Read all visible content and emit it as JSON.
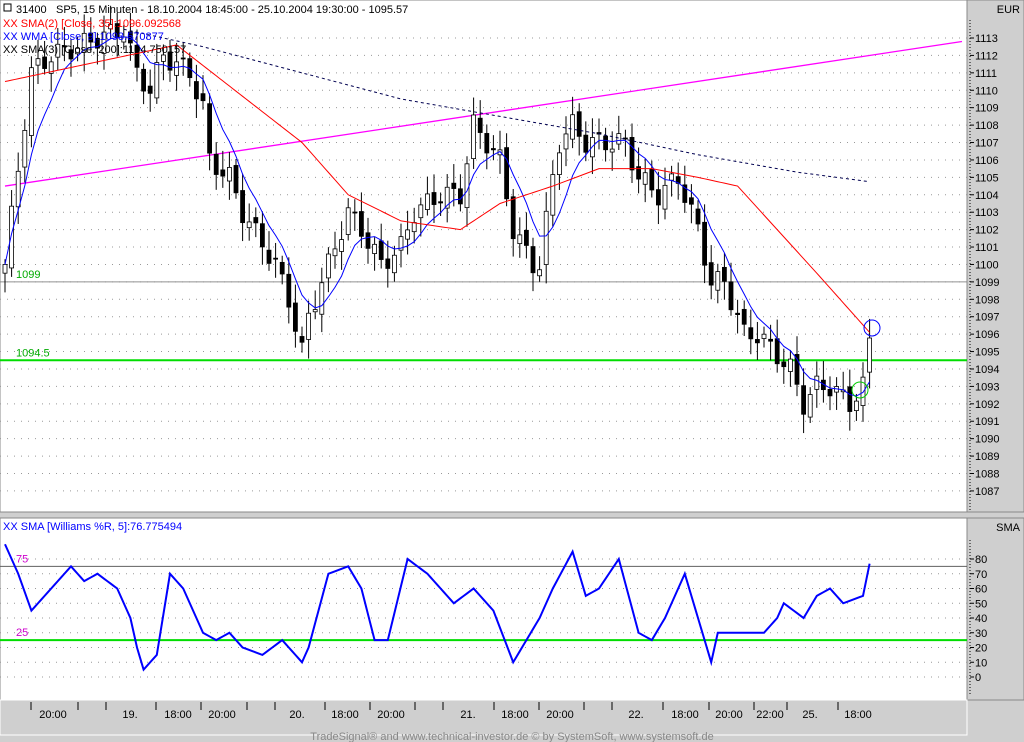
{
  "header": {
    "symbol_id": "31400",
    "title": "SP5, 15 Minuten - 18.10.2004 18:45:00 - 25.10.2004 19:30:00 - 1095.57",
    "legend": [
      {
        "text": "XX SMA(2) [Close, 35]:1096.092568",
        "color": "#ff0000"
      },
      {
        "text": "XX WMA [Close, 9]:1093.570877",
        "color": "#0000ff"
      },
      {
        "text": "XX SMA(3) [Close, 200]:1104.750157",
        "color": "#000000"
      }
    ]
  },
  "lower_legend": {
    "text": "XX SMA [Williams %R, 5]:76.775494",
    "color": "#0000ff"
  },
  "currency": "EUR",
  "lower_axis_label": "SMA",
  "footer": "TradeSignal® and www.technical-investor.de © by SystemSoft, www.systemsoft.de",
  "colors": {
    "sma35": "#ff0000",
    "wma9": "#0000ff",
    "sma200": "#000050",
    "trend": "#ff00ff",
    "support": "#00dd00",
    "resistance": "#909090",
    "wr": "#0000ff"
  },
  "chart_data": [
    {
      "type": "candlestick",
      "title": "SP5, 15 Minuten",
      "ylabel": "EUR",
      "ylim": [
        1086,
        1114
      ],
      "yticks": [
        1087,
        1088,
        1089,
        1090,
        1091,
        1092,
        1093,
        1094,
        1095,
        1096,
        1097,
        1098,
        1099,
        1100,
        1101,
        1102,
        1103,
        1104,
        1105,
        1106,
        1107,
        1108,
        1109,
        1110,
        1111,
        1112,
        1113
      ],
      "bars": 132,
      "close_keypoints": [
        [
          0,
          1100
        ],
        [
          4,
          1111
        ],
        [
          7,
          1112
        ],
        [
          11,
          1112.5
        ],
        [
          14,
          1113
        ],
        [
          18,
          1113.5
        ],
        [
          20,
          1111
        ],
        [
          22,
          1110
        ],
        [
          24,
          1112
        ],
        [
          28,
          1111
        ],
        [
          30,
          1109
        ],
        [
          31,
          1106
        ],
        [
          34,
          1105
        ],
        [
          36,
          1103
        ],
        [
          41,
          1100
        ],
        [
          43,
          1098
        ],
        [
          45,
          1095
        ],
        [
          46,
          1097
        ],
        [
          49,
          1100
        ],
        [
          52,
          1103
        ],
        [
          54,
          1102
        ],
        [
          57,
          1100
        ],
        [
          60,
          1101
        ],
        [
          62,
          1103
        ],
        [
          66,
          1104
        ],
        [
          69,
          1104
        ],
        [
          71,
          1108
        ],
        [
          73,
          1107
        ],
        [
          75,
          1106
        ],
        [
          77,
          1102
        ],
        [
          80,
          1100
        ],
        [
          81,
          1100
        ],
        [
          83,
          1105
        ],
        [
          84,
          1107
        ],
        [
          86,
          1108
        ],
        [
          88,
          1107
        ],
        [
          92,
          1107
        ],
        [
          94,
          1107
        ],
        [
          96,
          1105
        ],
        [
          99,
          1104
        ],
        [
          102,
          1105
        ],
        [
          105,
          1102
        ],
        [
          107,
          1099
        ],
        [
          109,
          1099
        ],
        [
          111,
          1097
        ],
        [
          112,
          1096
        ],
        [
          114,
          1096
        ],
        [
          119,
          1094
        ],
        [
          121,
          1092
        ],
        [
          123,
          1093
        ],
        [
          125,
          1093
        ],
        [
          128,
          1092
        ],
        [
          130,
          1093
        ],
        [
          131,
          1095.57
        ]
      ],
      "series": [
        {
          "name": "SMA(2) [Close, 35]",
          "points": [
            [
              0,
              1110.5
            ],
            [
              26,
              1112.6
            ],
            [
              45,
              1107
            ],
            [
              52,
              1104
            ],
            [
              60,
              1102.5
            ],
            [
              69,
              1102
            ],
            [
              75,
              1103.5
            ],
            [
              83,
              1104.5
            ],
            [
              90,
              1105.5
            ],
            [
              98,
              1105.5
            ],
            [
              105,
              1105
            ],
            [
              111,
              1104.5
            ],
            [
              117,
              1102
            ],
            [
              123,
              1099.5
            ],
            [
              131,
              1096.1
            ]
          ]
        },
        {
          "name": "SMA(3) [Close, 200]",
          "points": [
            [
              18,
              1113.5
            ],
            [
              30,
              1112.5
            ],
            [
              45,
              1111
            ],
            [
              60,
              1109.5
            ],
            [
              75,
              1108.5
            ],
            [
              90,
              1107.5
            ],
            [
              105,
              1106.3
            ],
            [
              120,
              1105.3
            ],
            [
              131,
              1104.75
            ]
          ]
        }
      ],
      "lines": [
        {
          "name": "trendline",
          "from": [
            0,
            1104.5
          ],
          "to": [
            145,
            1112.8
          ]
        },
        {
          "name": "horizontal",
          "value": 1099,
          "label": "1099"
        },
        {
          "name": "horizontal",
          "value": 1094.5,
          "label": "1094.5"
        }
      ],
      "x_labels": [
        "20:00",
        "19.",
        "18:00",
        "20:00",
        "20.",
        "18:00",
        "20:00",
        "21.",
        "18:00",
        "20:00",
        "22.",
        "18:00",
        "20:00",
        "22:00",
        "25.",
        "18:00"
      ]
    },
    {
      "type": "line",
      "title": "SMA [Williams %R, 5]",
      "ylabel": "SMA",
      "ylim": [
        -5,
        90
      ],
      "yticks": [
        0,
        10,
        20,
        30,
        40,
        50,
        60,
        70,
        80
      ],
      "levels": [
        {
          "value": 75,
          "label": "75"
        },
        {
          "value": 25,
          "label": "25"
        }
      ],
      "points": [
        [
          0,
          90
        ],
        [
          2,
          70
        ],
        [
          4,
          45
        ],
        [
          6,
          55
        ],
        [
          8,
          65
        ],
        [
          10,
          75
        ],
        [
          12,
          65
        ],
        [
          14,
          70
        ],
        [
          17,
          60
        ],
        [
          19,
          40
        ],
        [
          20,
          20
        ],
        [
          21,
          5
        ],
        [
          23,
          15
        ],
        [
          25,
          70
        ],
        [
          27,
          60
        ],
        [
          30,
          30
        ],
        [
          32,
          25
        ],
        [
          34,
          30
        ],
        [
          36,
          20
        ],
        [
          39,
          15
        ],
        [
          42,
          25
        ],
        [
          45,
          10
        ],
        [
          46,
          20
        ],
        [
          49,
          70
        ],
        [
          52,
          75
        ],
        [
          54,
          60
        ],
        [
          56,
          25
        ],
        [
          58,
          25
        ],
        [
          61,
          80
        ],
        [
          64,
          70
        ],
        [
          68,
          50
        ],
        [
          71,
          60
        ],
        [
          74,
          45
        ],
        [
          77,
          10
        ],
        [
          79,
          25
        ],
        [
          81,
          40
        ],
        [
          83,
          60
        ],
        [
          86,
          85
        ],
        [
          88,
          55
        ],
        [
          90,
          60
        ],
        [
          93,
          80
        ],
        [
          96,
          30
        ],
        [
          98,
          25
        ],
        [
          100,
          40
        ],
        [
          103,
          70
        ],
        [
          105,
          40
        ],
        [
          107,
          10
        ],
        [
          108,
          30
        ],
        [
          111,
          30
        ],
        [
          115,
          30
        ],
        [
          117,
          40
        ],
        [
          118,
          50
        ],
        [
          121,
          40
        ],
        [
          123,
          55
        ],
        [
          125,
          60
        ],
        [
          127,
          50
        ],
        [
          130,
          55
        ],
        [
          131,
          76.8
        ]
      ]
    }
  ]
}
